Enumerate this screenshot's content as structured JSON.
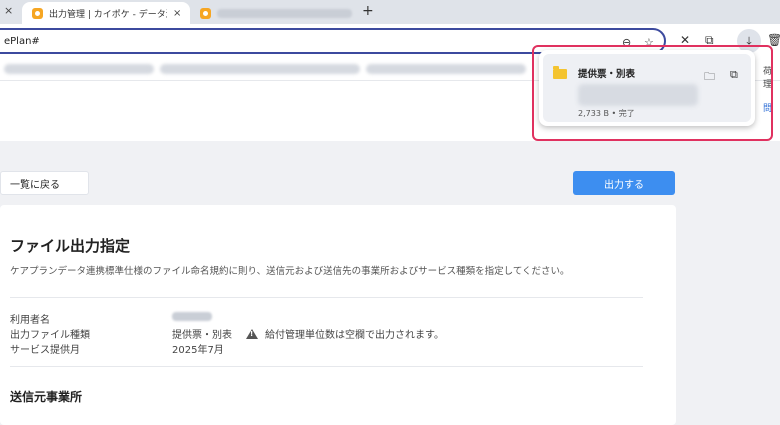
{
  "browser": {
    "active_tab_title": "出力管理 | カイポケ - データ連携(仮",
    "new_tab_label": "+",
    "url": "ePlan#",
    "tab_close": "×",
    "edge_text_top": "荷理",
    "edge_text_mid": "問"
  },
  "download": {
    "file_name": "提供票・別表",
    "status": "2,733 B • 完了"
  },
  "page": {
    "back_button": "一覧に戻る",
    "output_button": "出力する",
    "card_title": "ファイル出力指定",
    "description": "ケアプランデータ連携標準仕様のファイル命名規約に則り、送信元および送信先の事業所およびサービス種類を指定してください。",
    "fields": [
      {
        "label": "利用者名",
        "value": ""
      },
      {
        "label": "出力ファイル種類",
        "value": "提供票・別表"
      },
      {
        "label": "サービス提供月",
        "value": "2025年7月"
      }
    ],
    "warning": "給付管理単位数は空欄で出力されます。",
    "section_title": "送信元事業所"
  },
  "icons": {
    "zoom": "zoom-icon",
    "star": "bookmark-star-icon",
    "extensions": "puzzle-icon",
    "download": "download-icon",
    "trash": "trash-icon"
  }
}
